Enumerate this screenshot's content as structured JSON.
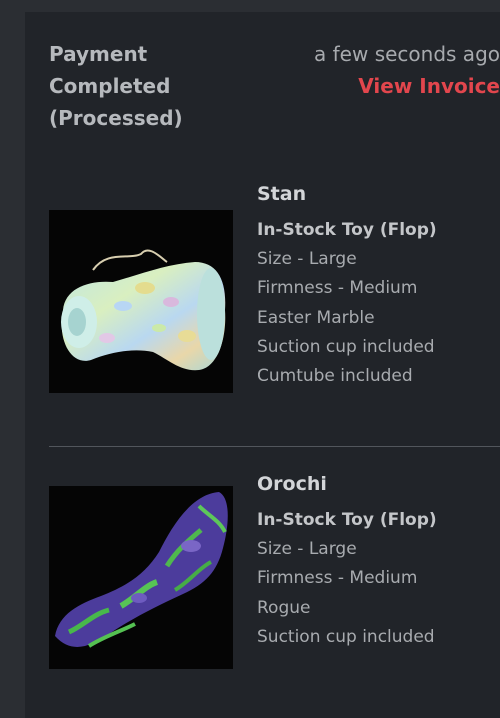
{
  "order": {
    "status": "Payment\nCompleted\n(Processed)",
    "time": "a few seconds ago",
    "invoice_label": "View Invoice"
  },
  "items": [
    {
      "name": "Stan",
      "type": "In-Stock Toy (Flop)",
      "attributes": [
        "Size - Large",
        "Firmness - Medium",
        "Easter Marble",
        "Suction cup included",
        "Cumtube included"
      ]
    },
    {
      "name": "Orochi",
      "type": "In-Stock Toy (Flop)",
      "attributes": [
        "Size - Large",
        "Firmness - Medium",
        "Rogue",
        "Suction cup included"
      ]
    }
  ]
}
